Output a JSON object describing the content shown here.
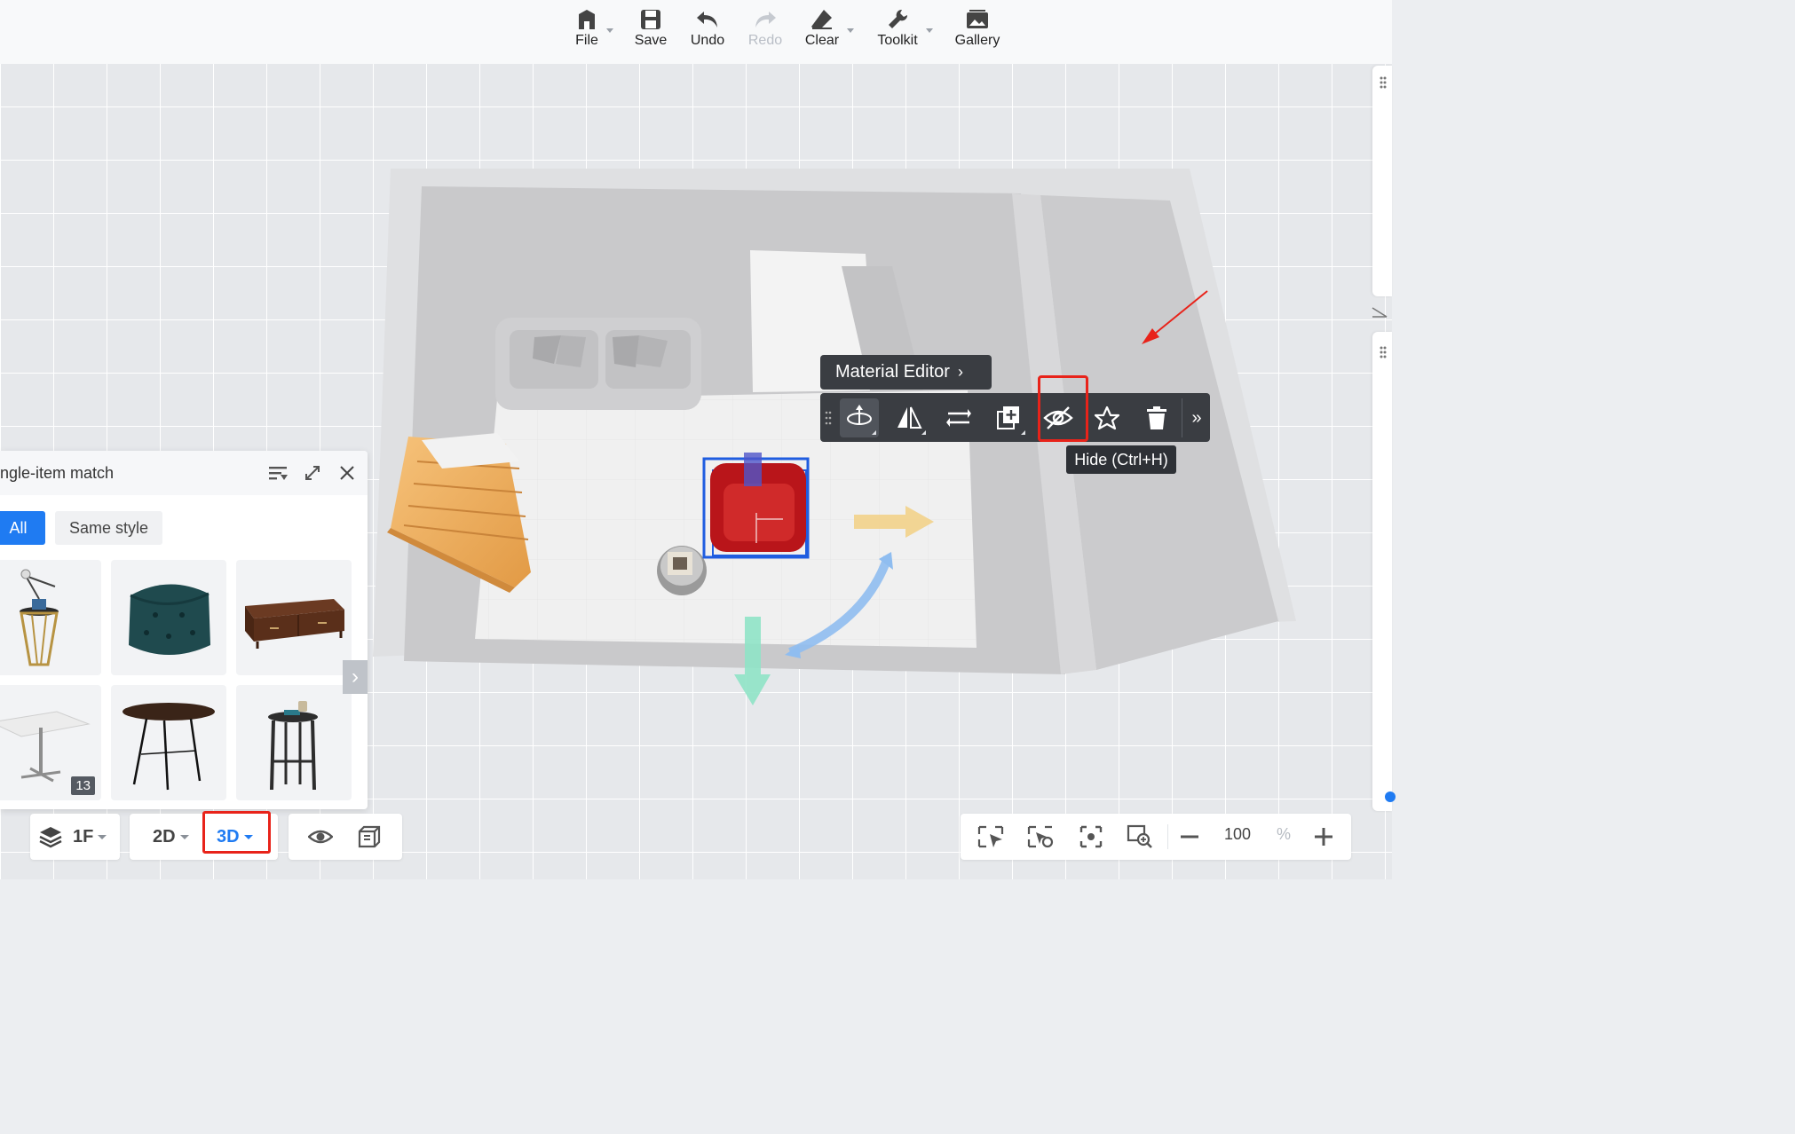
{
  "toolbar": {
    "file": "File",
    "save": "Save",
    "undo": "Undo",
    "redo": "Redo",
    "clear": "Clear",
    "toolkit": "Toolkit",
    "gallery": "Gallery"
  },
  "object_toolbar": {
    "material_editor": "Material Editor",
    "hide_tooltip": "Hide (Ctrl+H)"
  },
  "match_panel": {
    "title": "ngle-item match",
    "tabs": [
      "All",
      "Same style"
    ],
    "active_tab": "All",
    "items": [
      "side-table-with-lamp",
      "tufted-ottoman",
      "tv-console",
      "square-table",
      "oval-table",
      "round-stool-table"
    ],
    "count_badge": "13"
  },
  "bottom_left": {
    "floor": "1F",
    "view_2d": "2D",
    "view_3d": "3D",
    "active_view": "3D"
  },
  "zoom": {
    "value": "100",
    "unit": "%"
  },
  "colors": {
    "accent": "#1f7bf2",
    "highlight_red": "#e8231a",
    "toolbar_dark": "#3a3d42",
    "selected_object": "#c41e1e"
  }
}
